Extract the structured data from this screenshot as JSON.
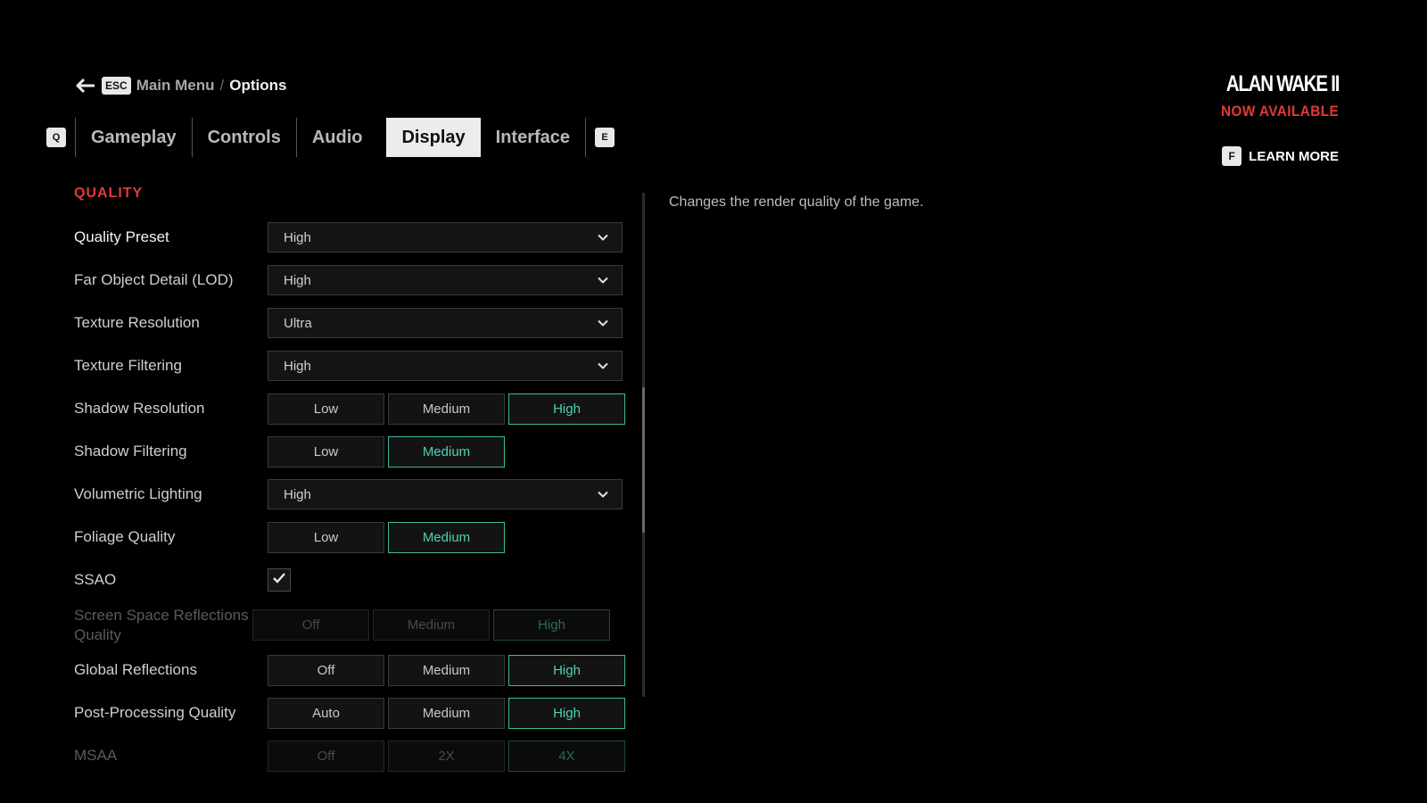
{
  "header": {
    "back_key": "ESC",
    "breadcrumb_main": "Main Menu",
    "breadcrumb_sep": "/",
    "breadcrumb_current": "Options"
  },
  "tabs": {
    "prev_key": "Q",
    "next_key": "E",
    "items": [
      "Gameplay",
      "Controls",
      "Audio",
      "Display",
      "Interface"
    ],
    "active": "Display"
  },
  "promo": {
    "logo": "ALAN WAKE II",
    "subtitle": "NOW AVAILABLE",
    "learn_key": "F",
    "learn_label": "LEARN MORE"
  },
  "section": {
    "title": "QUALITY"
  },
  "settings": [
    {
      "label": "Quality Preset",
      "type": "dropdown",
      "value": "High",
      "highlight": true
    },
    {
      "label": "Far Object Detail (LOD)",
      "type": "dropdown",
      "value": "High"
    },
    {
      "label": "Texture Resolution",
      "type": "dropdown",
      "value": "Ultra"
    },
    {
      "label": "Texture Filtering",
      "type": "dropdown",
      "value": "High"
    },
    {
      "label": "Shadow Resolution",
      "type": "segmented",
      "options": [
        "Low",
        "Medium",
        "High"
      ],
      "selected": "High"
    },
    {
      "label": "Shadow Filtering",
      "type": "segmented",
      "options": [
        "Low",
        "Medium"
      ],
      "selected": "Medium"
    },
    {
      "label": "Volumetric Lighting",
      "type": "dropdown",
      "value": "High"
    },
    {
      "label": "Foliage Quality",
      "type": "segmented",
      "options": [
        "Low",
        "Medium"
      ],
      "selected": "Medium"
    },
    {
      "label": "SSAO",
      "type": "checkbox",
      "checked": true
    },
    {
      "label": "Screen Space Reflections Quality",
      "type": "segmented",
      "options": [
        "Off",
        "Medium",
        "High"
      ],
      "selected": "High",
      "disabled": true
    },
    {
      "label": "Global Reflections",
      "type": "segmented",
      "options": [
        "Off",
        "Medium",
        "High"
      ],
      "selected": "High"
    },
    {
      "label": "Post-Processing Quality",
      "type": "segmented",
      "options": [
        "Auto",
        "Medium",
        "High"
      ],
      "selected": "High"
    },
    {
      "label": "MSAA",
      "type": "segmented",
      "options": [
        "Off",
        "2X",
        "4X"
      ],
      "selected": "4X",
      "disabled": true
    }
  ],
  "description": "Changes the render quality of the game.",
  "colors": {
    "accent_red": "#e03a3a",
    "selected_teal": "#4fd0b4",
    "background": "#000000"
  }
}
